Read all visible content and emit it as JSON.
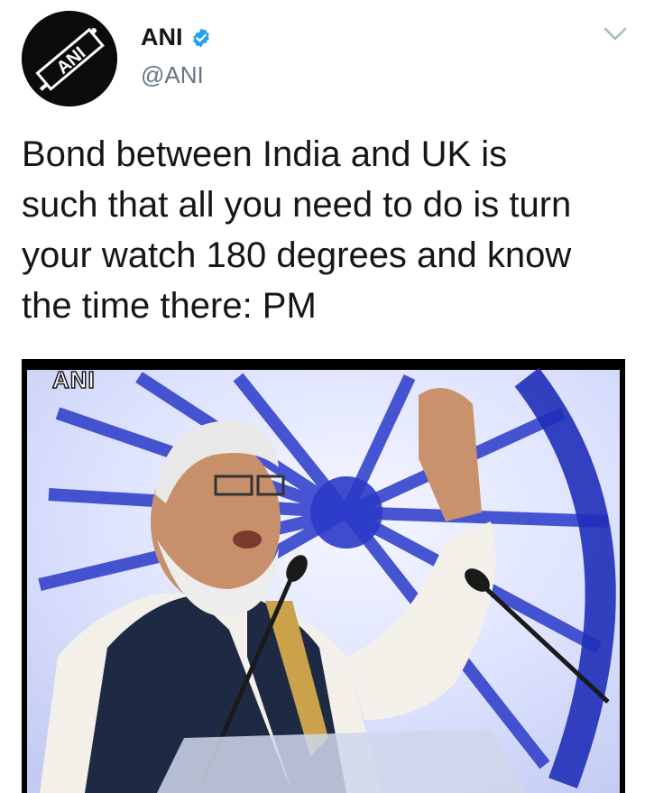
{
  "tweet": {
    "author_name": "ANI",
    "author_handle": "@ANI",
    "verified": true,
    "avatar_label": "ANI",
    "text": "Bond between India and UK is\nsuch that all you need to do is turn\nyour watch 180 degrees and know\nthe time there: PM",
    "media_watermark": "ANI",
    "media_description": "A man in a white kurta and dark vest speaking at a podium microphone with his hand raised, in front of a blue chakra background"
  },
  "icons": {
    "verified": "verified-badge-icon",
    "menu": "chevron-down-icon"
  },
  "colors": {
    "verified_blue": "#1da1f2",
    "handle_gray": "#657786",
    "text": "#14171a"
  }
}
